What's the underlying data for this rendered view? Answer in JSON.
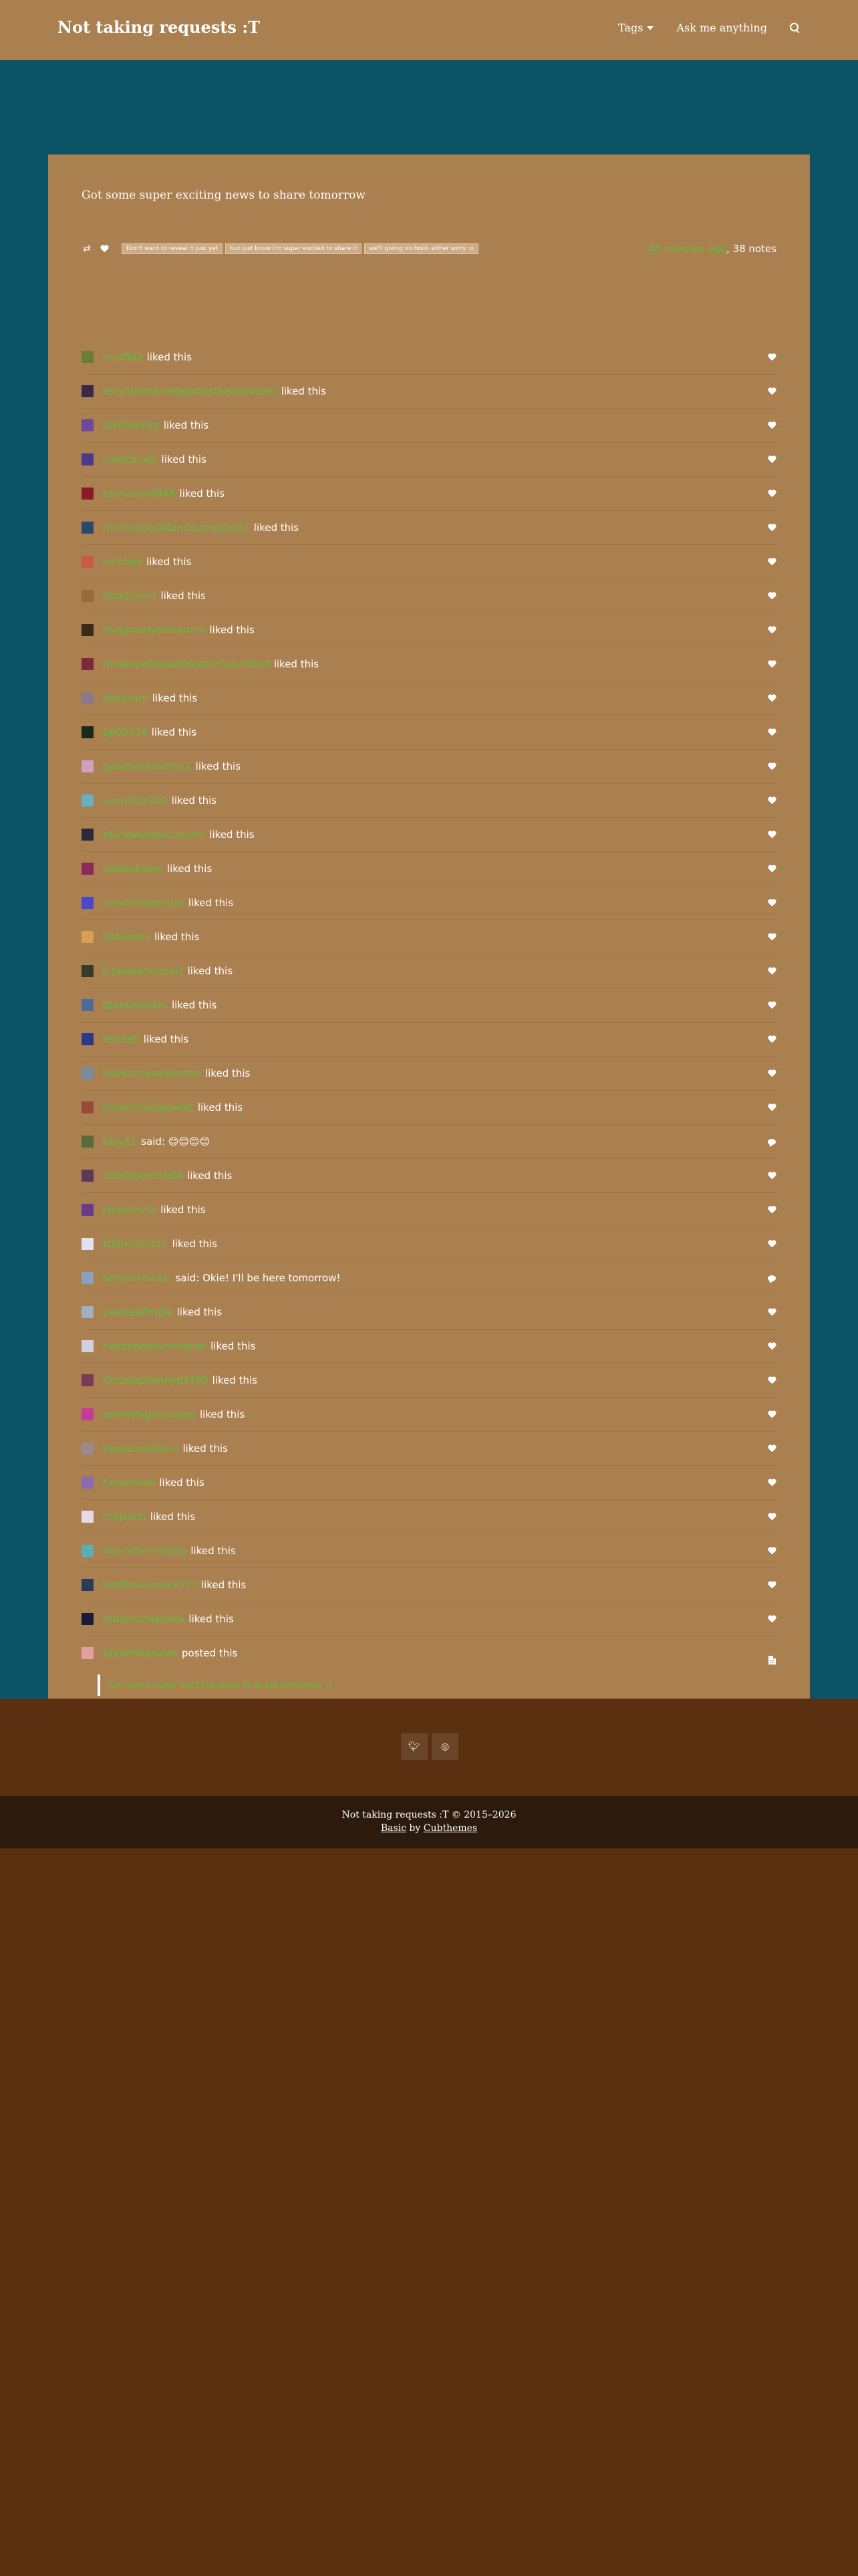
{
  "header": {
    "title": "Not taking requests :T",
    "nav": {
      "tags": "Tags",
      "ask": "Ask me anything"
    }
  },
  "post": {
    "text": "Got some super exciting news to share tomorrow",
    "tags": [
      "Don't want to reveal it just yet",
      "but just know i'm super excited to share it",
      "we'll giving on hold- either sorry :o"
    ],
    "time": "46 minutes ago",
    "notes_count": ", 38 notes"
  },
  "notes": [
    {
      "user": "mzaftaz",
      "action": "liked this",
      "type": "like",
      "avatar": "#6b7b3a"
    },
    {
      "user": "lenymarrakvedayjstastbeanadbest",
      "action": "liked this",
      "type": "like",
      "avatar": "#3a2a4a"
    },
    {
      "user": "sortfamisty",
      "action": "liked this",
      "type": "like",
      "avatar": "#6b4a9a"
    },
    {
      "user": "silentblueli",
      "action": "liked this",
      "type": "like",
      "avatar": "#4a3a8a"
    },
    {
      "user": "lunnakiss6888",
      "action": "liked this",
      "type": "like",
      "avatar": "#8a1a2a"
    },
    {
      "user": "mermaidoradandoumed2021",
      "action": "liked this",
      "type": "like",
      "avatar": "#2a4a6a"
    },
    {
      "user": "nicotiak",
      "action": "liked this",
      "type": "like",
      "avatar": "#c85a4a"
    },
    {
      "user": "doddlyrem",
      "action": "liked this",
      "type": "like",
      "avatar": "#9a6a3a"
    },
    {
      "user": "theghostlycinnamon",
      "action": "liked this",
      "type": "like",
      "avatar": "#3a2a1a"
    },
    {
      "user": "mmanyellowsarfacesortyourshelf",
      "action": "liked this",
      "type": "like",
      "avatar": "#7a2a3a"
    },
    {
      "user": "dailysum",
      "action": "liked this",
      "type": "like",
      "avatar": "#8a7a8a"
    },
    {
      "user": "bp09234",
      "action": "liked this",
      "type": "like",
      "avatar": "#1a2a1a"
    },
    {
      "user": "pearlbentos0m11",
      "action": "liked this",
      "type": "like",
      "avatar": "#d0a0c0"
    },
    {
      "user": "sunnyfox210",
      "action": "liked this",
      "type": "like",
      "avatar": "#6ab0c0"
    },
    {
      "user": "pluckwasdaocasions",
      "action": "liked this",
      "type": "like",
      "avatar": "#2a2a3a"
    },
    {
      "user": "walkadrawn",
      "action": "liked this",
      "type": "like",
      "avatar": "#8a2a5a"
    },
    {
      "user": "veralineshangsz",
      "action": "liked this",
      "type": "like",
      "avatar": "#4a4ac8"
    },
    {
      "user": "kbboozes",
      "action": "liked this",
      "type": "like",
      "avatar": "#d8a050"
    },
    {
      "user": "kipuaaamcesalz",
      "action": "liked this",
      "type": "like",
      "avatar": "#3a3a2a"
    },
    {
      "user": "tbeeljwnoom",
      "action": "liked this",
      "type": "like",
      "avatar": "#4a6a9a"
    },
    {
      "user": "leoleeh",
      "action": "liked this",
      "type": "like",
      "avatar": "#2a3a8a"
    },
    {
      "user": "baekachewimeuthe",
      "action": "liked this",
      "type": "like",
      "avatar": "#7a8aa0"
    },
    {
      "user": "jimikerialkedowlet",
      "action": "liked this",
      "type": "like",
      "avatar": "#9a4a3a"
    },
    {
      "user": "bbjy11",
      "action": "said: 😊😊😊😊",
      "type": "reply",
      "avatar": "#5a6a3a"
    },
    {
      "user": "adultsbanesh88",
      "action": "liked this",
      "type": "like",
      "avatar": "#5a3a5a"
    },
    {
      "user": "jackyrouse",
      "action": "liked this",
      "type": "like",
      "avatar": "#6a3a8a"
    },
    {
      "user": "kibbertails12",
      "action": "liked this",
      "type": "like",
      "avatar": "#e0e0f0"
    },
    {
      "user": "fenowlvmkelz",
      "action": "said: Okie! I'll be here tomorrow!",
      "type": "reply",
      "avatar": "#8aa0c0"
    },
    {
      "user": "yeasleaffingle",
      "action": "liked this",
      "type": "like",
      "avatar": "#a0b0c0"
    },
    {
      "user": "hakanadnounmaster",
      "action": "liked this",
      "type": "like",
      "avatar": "#d0d0e0"
    },
    {
      "user": "itsrosiephoneyd3785",
      "action": "liked this",
      "type": "like",
      "avatar": "#7a3a5a"
    },
    {
      "user": "seinnefsgenuiness",
      "action": "liked this",
      "type": "like",
      "avatar": "#c83a9a"
    },
    {
      "user": "kaposumeilly-n",
      "action": "liked this",
      "type": "like",
      "avatar": "#9a8a8a"
    },
    {
      "user": "fumoloveil",
      "action": "liked this",
      "type": "like",
      "avatar": "#8a6ab0"
    },
    {
      "user": "crltjsenh",
      "action": "liked this",
      "type": "like",
      "avatar": "#e8d8e8"
    },
    {
      "user": "dlw-orben-bigslp",
      "action": "liked this",
      "type": "like",
      "avatar": "#5ab0b0"
    },
    {
      "user": "bettbee-snow4377",
      "action": "liked this",
      "type": "like",
      "avatar": "#2a3a5a"
    },
    {
      "user": "orbsanchaspilea",
      "action": "liked this",
      "type": "like",
      "avatar": "#1a1a3a"
    }
  ],
  "poster": {
    "user": "bbtylmhaeylee",
    "action": "posted this",
    "avatar": "#e0a0a0",
    "quote": "Got some super exciting news to share tomorrow :)"
  },
  "footer": {
    "copyright": "Not taking requests :T © 2015–2026",
    "theme": "Basic",
    "by": " by ",
    "author": "Cubthemes"
  }
}
